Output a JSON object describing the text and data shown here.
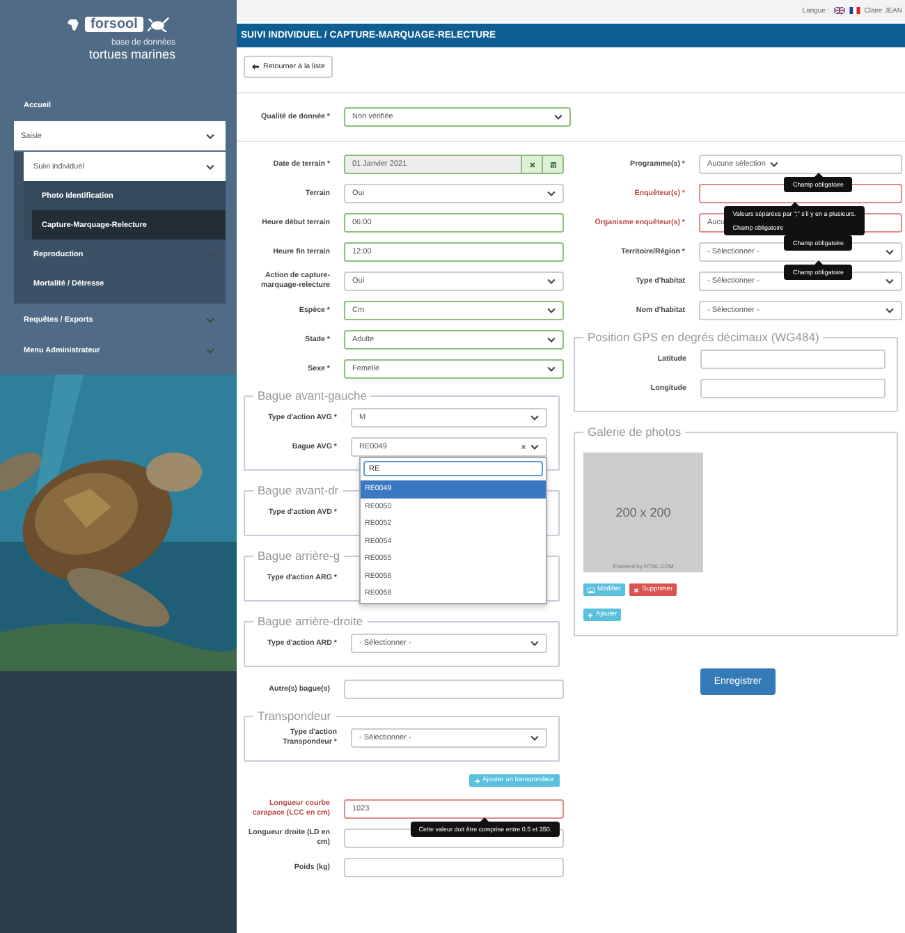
{
  "header": {
    "language_label": "Langue :",
    "user": "Claire JEAN"
  },
  "sidebar": {
    "logo": "forsool",
    "subtitle": "base de données",
    "title": "tortues marines",
    "menu": [
      {
        "label": "Accueil",
        "selected": false
      },
      {
        "label": "Saisie",
        "selected": false,
        "expanded": true,
        "children": [
          {
            "label": "Suivi individuel",
            "selected": false,
            "expanded": true,
            "children": [
              {
                "label": "Photo Identification",
                "selected": false
              },
              {
                "label": "Capture-Marquage-Relecture",
                "selected": true
              }
            ]
          },
          {
            "label": "Reproduction",
            "selected": false,
            "expanded": false
          },
          {
            "label": "Mortalité / Détresse",
            "selected": false
          }
        ]
      },
      {
        "label": "Requêtes / Exports",
        "selected": false,
        "expanded": false
      },
      {
        "label": "Menu Administrateur",
        "selected": false,
        "expanded": false
      }
    ]
  },
  "page_title": "SUIVI INDIVIDUEL / CAPTURE-MARQUAGE-RELECTURE",
  "back_button": "Retourner à la liste",
  "quality": {
    "kind": "select",
    "label": "Qualité de donnée *",
    "value": "Non vérifiée",
    "valid": true,
    "invalid": false
  },
  "left_column": [
    {
      "kind": "date",
      "label": "Date de terrain *",
      "value": "01 Janvier 2021",
      "valid": true,
      "invalid": false
    },
    {
      "kind": "select",
      "label": "Terrain",
      "value": "Oui",
      "valid": false,
      "invalid": false
    },
    {
      "kind": "input",
      "label": "Heure début terrain",
      "value": "06:00",
      "valid": true,
      "invalid": false
    },
    {
      "kind": "input",
      "label": "Heure fin terrain",
      "value": "12:00",
      "valid": true,
      "invalid": false
    },
    {
      "kind": "select",
      "label": "Action de capture-marquage-relecture",
      "value": "Oui",
      "valid": false,
      "invalid": false
    },
    {
      "kind": "select",
      "label": "Espèce *",
      "value": "Cm",
      "valid": true,
      "invalid": false
    },
    {
      "kind": "select",
      "label": "Stade *",
      "value": "Adulte",
      "valid": true,
      "invalid": false
    },
    {
      "kind": "select",
      "label": "Sexe *",
      "value": "Femelle",
      "valid": true,
      "invalid": false
    },
    {
      "kind": "group",
      "legend": "Bague avant-gauche",
      "fields": [
        {
          "kind": "select",
          "label": "Type d'action AVG *",
          "value": "M",
          "valid": false,
          "invalid": false
        },
        {
          "kind": "combo",
          "label": "Bague AVG *",
          "value": "RE0049",
          "valid": false,
          "invalid": false,
          "dropdown": {
            "search": "RE",
            "options": [
              {
                "label": "RE0049",
                "selected": true
              },
              {
                "label": "RE0050",
                "selected": false
              },
              {
                "label": "RE0052",
                "selected": false
              },
              {
                "label": "RE0054",
                "selected": false
              },
              {
                "label": "RE0055",
                "selected": false
              },
              {
                "label": "RE0056",
                "selected": false
              },
              {
                "label": "RE0058",
                "selected": false
              }
            ]
          }
        }
      ]
    },
    {
      "kind": "group",
      "legend": "Bague avant-dr",
      "fields": [
        {
          "kind": "covered",
          "label": "Type d'action AVD *"
        }
      ]
    },
    {
      "kind": "group",
      "legend": "Bague arrière-g",
      "fields": [
        {
          "kind": "covered",
          "label": "Type d'action ARG *"
        }
      ]
    },
    {
      "kind": "group",
      "legend": "Bague arrière-droite",
      "fields": [
        {
          "kind": "select",
          "label": "Type d'action ARD *",
          "value": "- Sélectionner -",
          "valid": false,
          "invalid": false
        }
      ]
    },
    {
      "kind": "input",
      "label": "Autre(s) bague(s)",
      "valid": false,
      "invalid": false
    },
    {
      "kind": "group",
      "legend": "Transpondeur",
      "fields": [
        {
          "kind": "select",
          "label": "Type d'action Transpondeur *",
          "value": "- Sélectionner -",
          "valid": false,
          "invalid": false
        }
      ]
    },
    {
      "kind": "add_button",
      "label": "Ajouter un transpondeur"
    },
    {
      "kind": "input",
      "label": "Longueur courbe carapace (LCC en cm)",
      "value": "1023",
      "valid": false,
      "invalid": true,
      "tooltip": [
        "Cette valeur doit être comprise entre 0.5 et 350."
      ]
    },
    {
      "kind": "input",
      "label": "Longueur droite (LD en cm)",
      "valid": false,
      "invalid": false
    },
    {
      "kind": "input",
      "label": "Poids (kg)",
      "valid": false,
      "invalid": false
    }
  ],
  "right_column": [
    {
      "kind": "multiselect",
      "label": "Programme(s) *",
      "value": "Aucune sélection",
      "valid": false,
      "invalid": false,
      "tooltip": [
        "Champ obligatoire"
      ]
    },
    {
      "kind": "input",
      "label": "Enquêteur(s) *",
      "valid": false,
      "invalid": true,
      "tooltip": [
        "Valeurs séparées par \";\" s'il y en a plusieurs.",
        "Champ obligatoire"
      ]
    },
    {
      "kind": "input",
      "label": "Organisme enquêteur(s) *",
      "value": "Aucu",
      "valid": false,
      "invalid": true,
      "tooltip": [
        "Champ obligatoire"
      ]
    },
    {
      "kind": "select",
      "label": "Territoire/Région *",
      "value": "- Sélectionner -",
      "valid": false,
      "invalid": false,
      "tooltip": [
        "Champ obligatoire"
      ]
    },
    {
      "kind": "select",
      "label": "Type d'habitat",
      "value": "- Sélectionner -",
      "valid": false,
      "invalid": false
    },
    {
      "kind": "select",
      "label": "Nom d'habitat",
      "value": "- Sélectionner -",
      "valid": false,
      "invalid": false
    },
    {
      "kind": "group",
      "legend": "Position GPS en degrés décimaux (WG484)",
      "fields": [
        {
          "kind": "input",
          "label": "Latitude",
          "valid": false,
          "invalid": false
        },
        {
          "kind": "input",
          "label": "Longitude",
          "valid": false,
          "invalid": false
        }
      ]
    },
    {
      "kind": "gallery",
      "legend": "Galerie de photos",
      "image_text": "200 x 200",
      "image_credit": "Powered by HTML.COM",
      "edit_button": "Modifier",
      "delete_button": "Supprimer",
      "add_button": "Ajouter"
    }
  ],
  "save_button": "Enregistrer"
}
